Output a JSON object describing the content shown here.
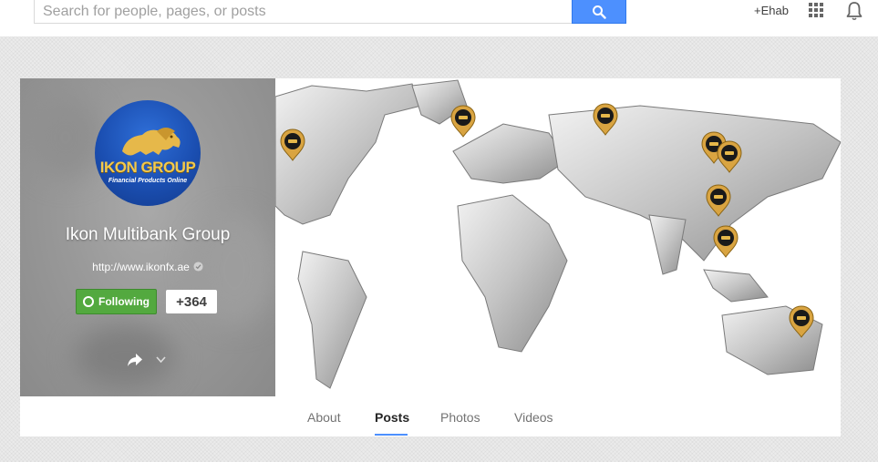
{
  "search": {
    "placeholder": "Search for people, pages, or posts"
  },
  "header": {
    "user_link": "+Ehab"
  },
  "profile": {
    "name": "Ikon Multibank Group",
    "url": "http://www.ikonfx.ae",
    "follow_label": "Following",
    "plus_count": "+364",
    "avatar_title": "IKON GROUP",
    "avatar_subtitle": "Financial Products Online"
  },
  "tabs": [
    {
      "label": "About"
    },
    {
      "label": "Posts"
    },
    {
      "label": "Photos"
    },
    {
      "label": "Videos"
    }
  ],
  "active_tab": "Posts",
  "colors": {
    "accent": "#4d90fe",
    "follow_green": "#53a93f",
    "pin_gold": "#d9a441"
  },
  "icons": [
    "search-icon",
    "apps-grid-icon",
    "notifications-bell-icon",
    "verified-check-icon",
    "following-circle-icon",
    "share-icon",
    "chevron-down-icon",
    "map-pin-icon"
  ]
}
